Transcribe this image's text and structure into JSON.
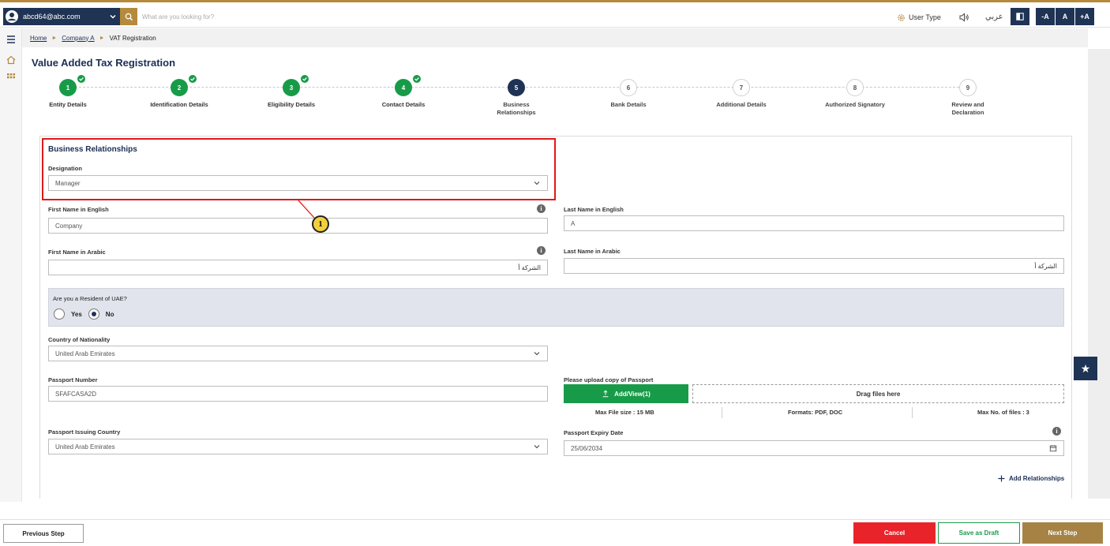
{
  "header": {
    "user_email": "abcd64@abc.com",
    "search_placeholder": "What are you looking for?",
    "user_type_label": "User Type",
    "language_label": "عربي",
    "font_minus_label": "-A",
    "font_normal_label": "A",
    "font_plus_label": "+A"
  },
  "breadcrumb": {
    "home": "Home",
    "company": "Company A",
    "current": "VAT Registration"
  },
  "page": {
    "title": "Value Added Tax Registration"
  },
  "steps": [
    {
      "number": "1",
      "label": "Entity Details",
      "status": "done"
    },
    {
      "number": "2",
      "label": "Identification Details",
      "status": "done"
    },
    {
      "number": "3",
      "label": "Eligibility Details",
      "status": "done"
    },
    {
      "number": "4",
      "label": "Contact Details",
      "status": "done"
    },
    {
      "number": "5",
      "label": "Business Relationships",
      "status": "current"
    },
    {
      "number": "6",
      "label": "Bank Details",
      "status": "todo"
    },
    {
      "number": "7",
      "label": "Additional Details",
      "status": "todo"
    },
    {
      "number": "8",
      "label": "Authorized Signatory",
      "status": "todo"
    },
    {
      "number": "9",
      "label": "Review and Declaration",
      "status": "todo"
    }
  ],
  "form": {
    "section_title": "Business Relationships",
    "designation": {
      "label": "Designation",
      "value": "Manager"
    },
    "first_name_en": {
      "label": "First Name in English",
      "value": "Company"
    },
    "last_name_en": {
      "label": "Last Name in English",
      "value": "A"
    },
    "first_name_ar": {
      "label": "First Name in Arabic",
      "value": "الشركة أ"
    },
    "last_name_ar": {
      "label": "Last Name in Arabic",
      "value": "الشركة أ"
    },
    "resident": {
      "question": "Are you a Resident of UAE?",
      "yes_label": "Yes",
      "no_label": "No",
      "selected": "No"
    },
    "nationality": {
      "label": "Country of Nationality",
      "value": "United Arab Emirates"
    },
    "passport_number": {
      "label": "Passport Number",
      "value": "SFAFCASA2D"
    },
    "passport_upload": {
      "label": "Please upload copy of Passport",
      "button_label": "Add/View(1)",
      "dropzone_label": "Drag files here",
      "max_size": "Max File size : 15 MB",
      "formats": "Formats: PDF, DOC",
      "max_files": "Max No. of files : 3"
    },
    "passport_country": {
      "label": "Passport Issuing Country",
      "value": "United Arab Emirates"
    },
    "passport_expiry": {
      "label": "Passport Expiry Date",
      "value": "25/06/2034"
    },
    "add_relationships_label": "Add Relationships"
  },
  "footer": {
    "previous_label": "Previous Step",
    "cancel_label": "Cancel",
    "draft_label": "Save as Draft",
    "next_label": "Next Step"
  },
  "annotation": {
    "callout_number": "1",
    "color": "#e01818"
  },
  "colors": {
    "navy": "#1f3355",
    "gold": "#b58a3c",
    "green": "#189b49",
    "red": "#e8242a"
  },
  "icons": [
    "user-avatar-icon",
    "chevron-down-icon",
    "search-icon",
    "gear-icon",
    "speaker-icon",
    "contrast-icon",
    "menu-icon",
    "home-icon",
    "grid-icon",
    "check-icon",
    "info-icon",
    "upload-icon",
    "calendar-icon",
    "plus-icon",
    "star-icon"
  ]
}
